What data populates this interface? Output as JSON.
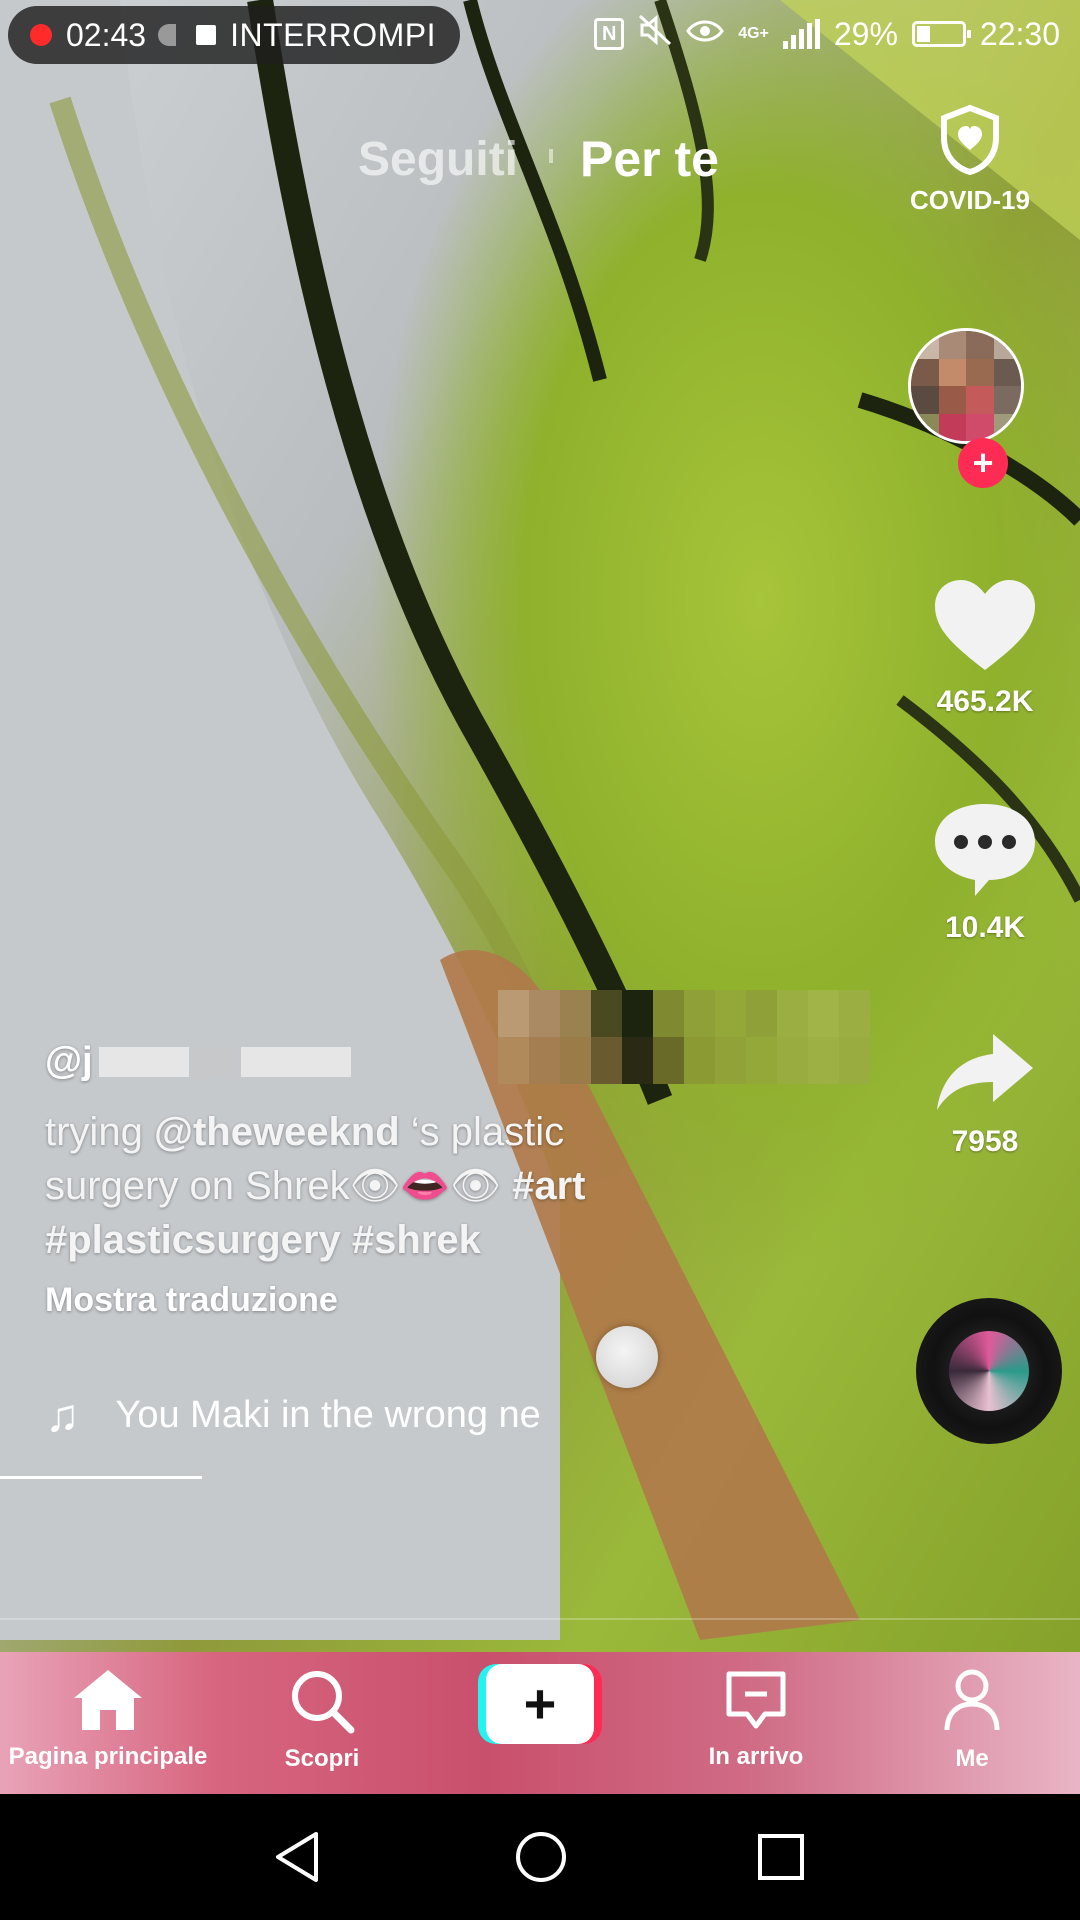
{
  "status_bar": {
    "recording_time": "02:43",
    "recording_action": "INTERROMPI",
    "battery": "29%",
    "battery_fraction": 0.29,
    "network": "4G+",
    "clock": "22:30"
  },
  "top_tabs": {
    "following": "Seguiti",
    "for_you": "Per te"
  },
  "covid_label": "COVID-19",
  "sidebar": {
    "likes": "465.2K",
    "comments": "10.4K",
    "shares": "7958"
  },
  "caption": {
    "username_prefix": "@j",
    "description_parts": [
      "trying ",
      "@theweeknd",
      " ‘s plastic surgery on Shrek👁👄👁 ",
      "#art",
      " ",
      "#plasticsurgery",
      " ",
      "#shrek"
    ],
    "translate_label": "Mostra traduzione"
  },
  "music": {
    "title": "You Maki in the wrong ne"
  },
  "bottom_nav": {
    "home": "Pagina principale",
    "discover": "Scopri",
    "inbox": "In arrivo",
    "me": "Me"
  },
  "colors": {
    "accent_red": "#fe2c55",
    "accent_cyan": "#25f4ee",
    "record_red": "#ff2a2a"
  }
}
